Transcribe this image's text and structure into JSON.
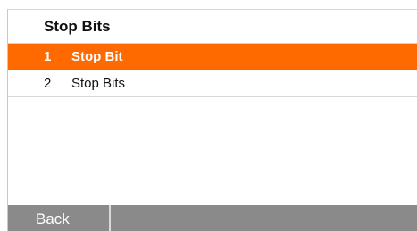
{
  "header": {
    "title": "Stop Bits"
  },
  "list": {
    "items": [
      {
        "number": "1",
        "label": "Stop Bit",
        "selected": true
      },
      {
        "number": "2",
        "label": "Stop Bits",
        "selected": false
      }
    ]
  },
  "footer": {
    "back_label": "Back"
  },
  "colors": {
    "accent": "#ff6a00",
    "footer_bg": "#8a8a8a"
  }
}
